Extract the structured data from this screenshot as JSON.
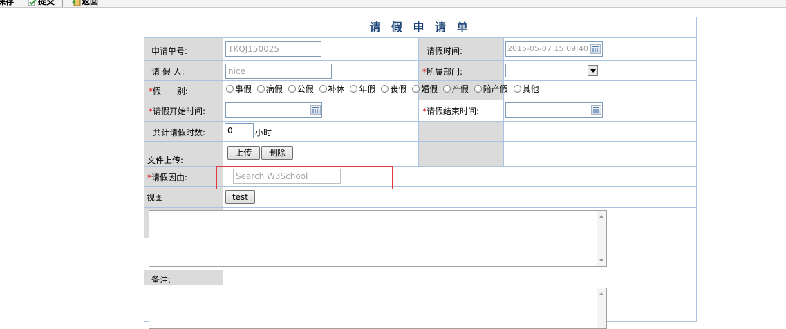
{
  "toolbar": {
    "save_label": "保存",
    "submit_label": "提交",
    "back_label": "返回"
  },
  "form": {
    "title": "请 假 申 请 单",
    "request_no_label": "申请单号:",
    "request_no_value": "TKQJ150025",
    "request_time_label": "请假时间:",
    "request_time_value": "2015-05-07 15:09:40",
    "applicant_label": "请 假 人:",
    "applicant_value": "nice",
    "dept_label": "所属部门:",
    "dept_value": "",
    "required_mark": "*",
    "type_label": "假      别:",
    "leave_types": [
      "事假",
      "病假",
      "公假",
      "补休",
      "年假",
      "丧假",
      "婚假",
      "产假",
      "陪产假",
      "其他"
    ],
    "start_label": "请假开始时间:",
    "end_label": "请假结束时间:",
    "hours_label": "共计请假时数:",
    "hours_value": "0",
    "hours_unit": "小时",
    "upload_label": "文件上传:",
    "upload_button": "上传",
    "delete_button": "删除",
    "reason_label": "请假因由:",
    "reason_placeholder": "Search W3School",
    "view_label": "视图",
    "test_button": "test",
    "notes_label": "备注:"
  },
  "colors": {
    "title": "#1d4476",
    "label_bg": "#dbdbdb",
    "grid_line": "#a8c4e0",
    "required": "#e00000",
    "highlight": "#e0393e"
  }
}
